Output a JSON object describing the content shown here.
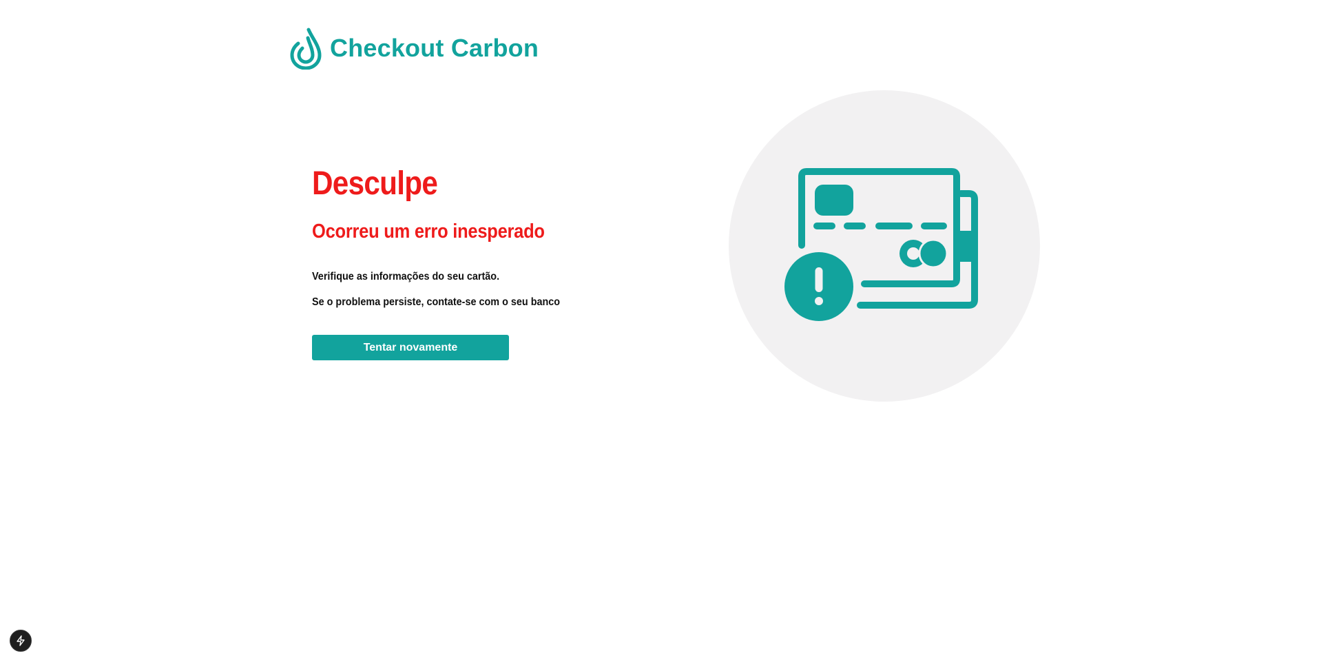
{
  "brand": {
    "name": "Checkout Carbon",
    "logo_icon": "droplet-logo-icon",
    "color": "#12a39d"
  },
  "error": {
    "title": "Desculpe",
    "subtitle": "Ocorreu um erro inesperado",
    "message_1": "Verifique as informações do seu cartão.",
    "message_2": "Se o problema persiste, contate-se com o seu banco",
    "color": "#ee1b1b"
  },
  "actions": {
    "retry_label": "Tentar novamente"
  },
  "illustration": {
    "icon": "credit-card-error-icon",
    "background_color": "#f2f1f2"
  },
  "devtools": {
    "icon": "lightning-bolt-icon"
  }
}
